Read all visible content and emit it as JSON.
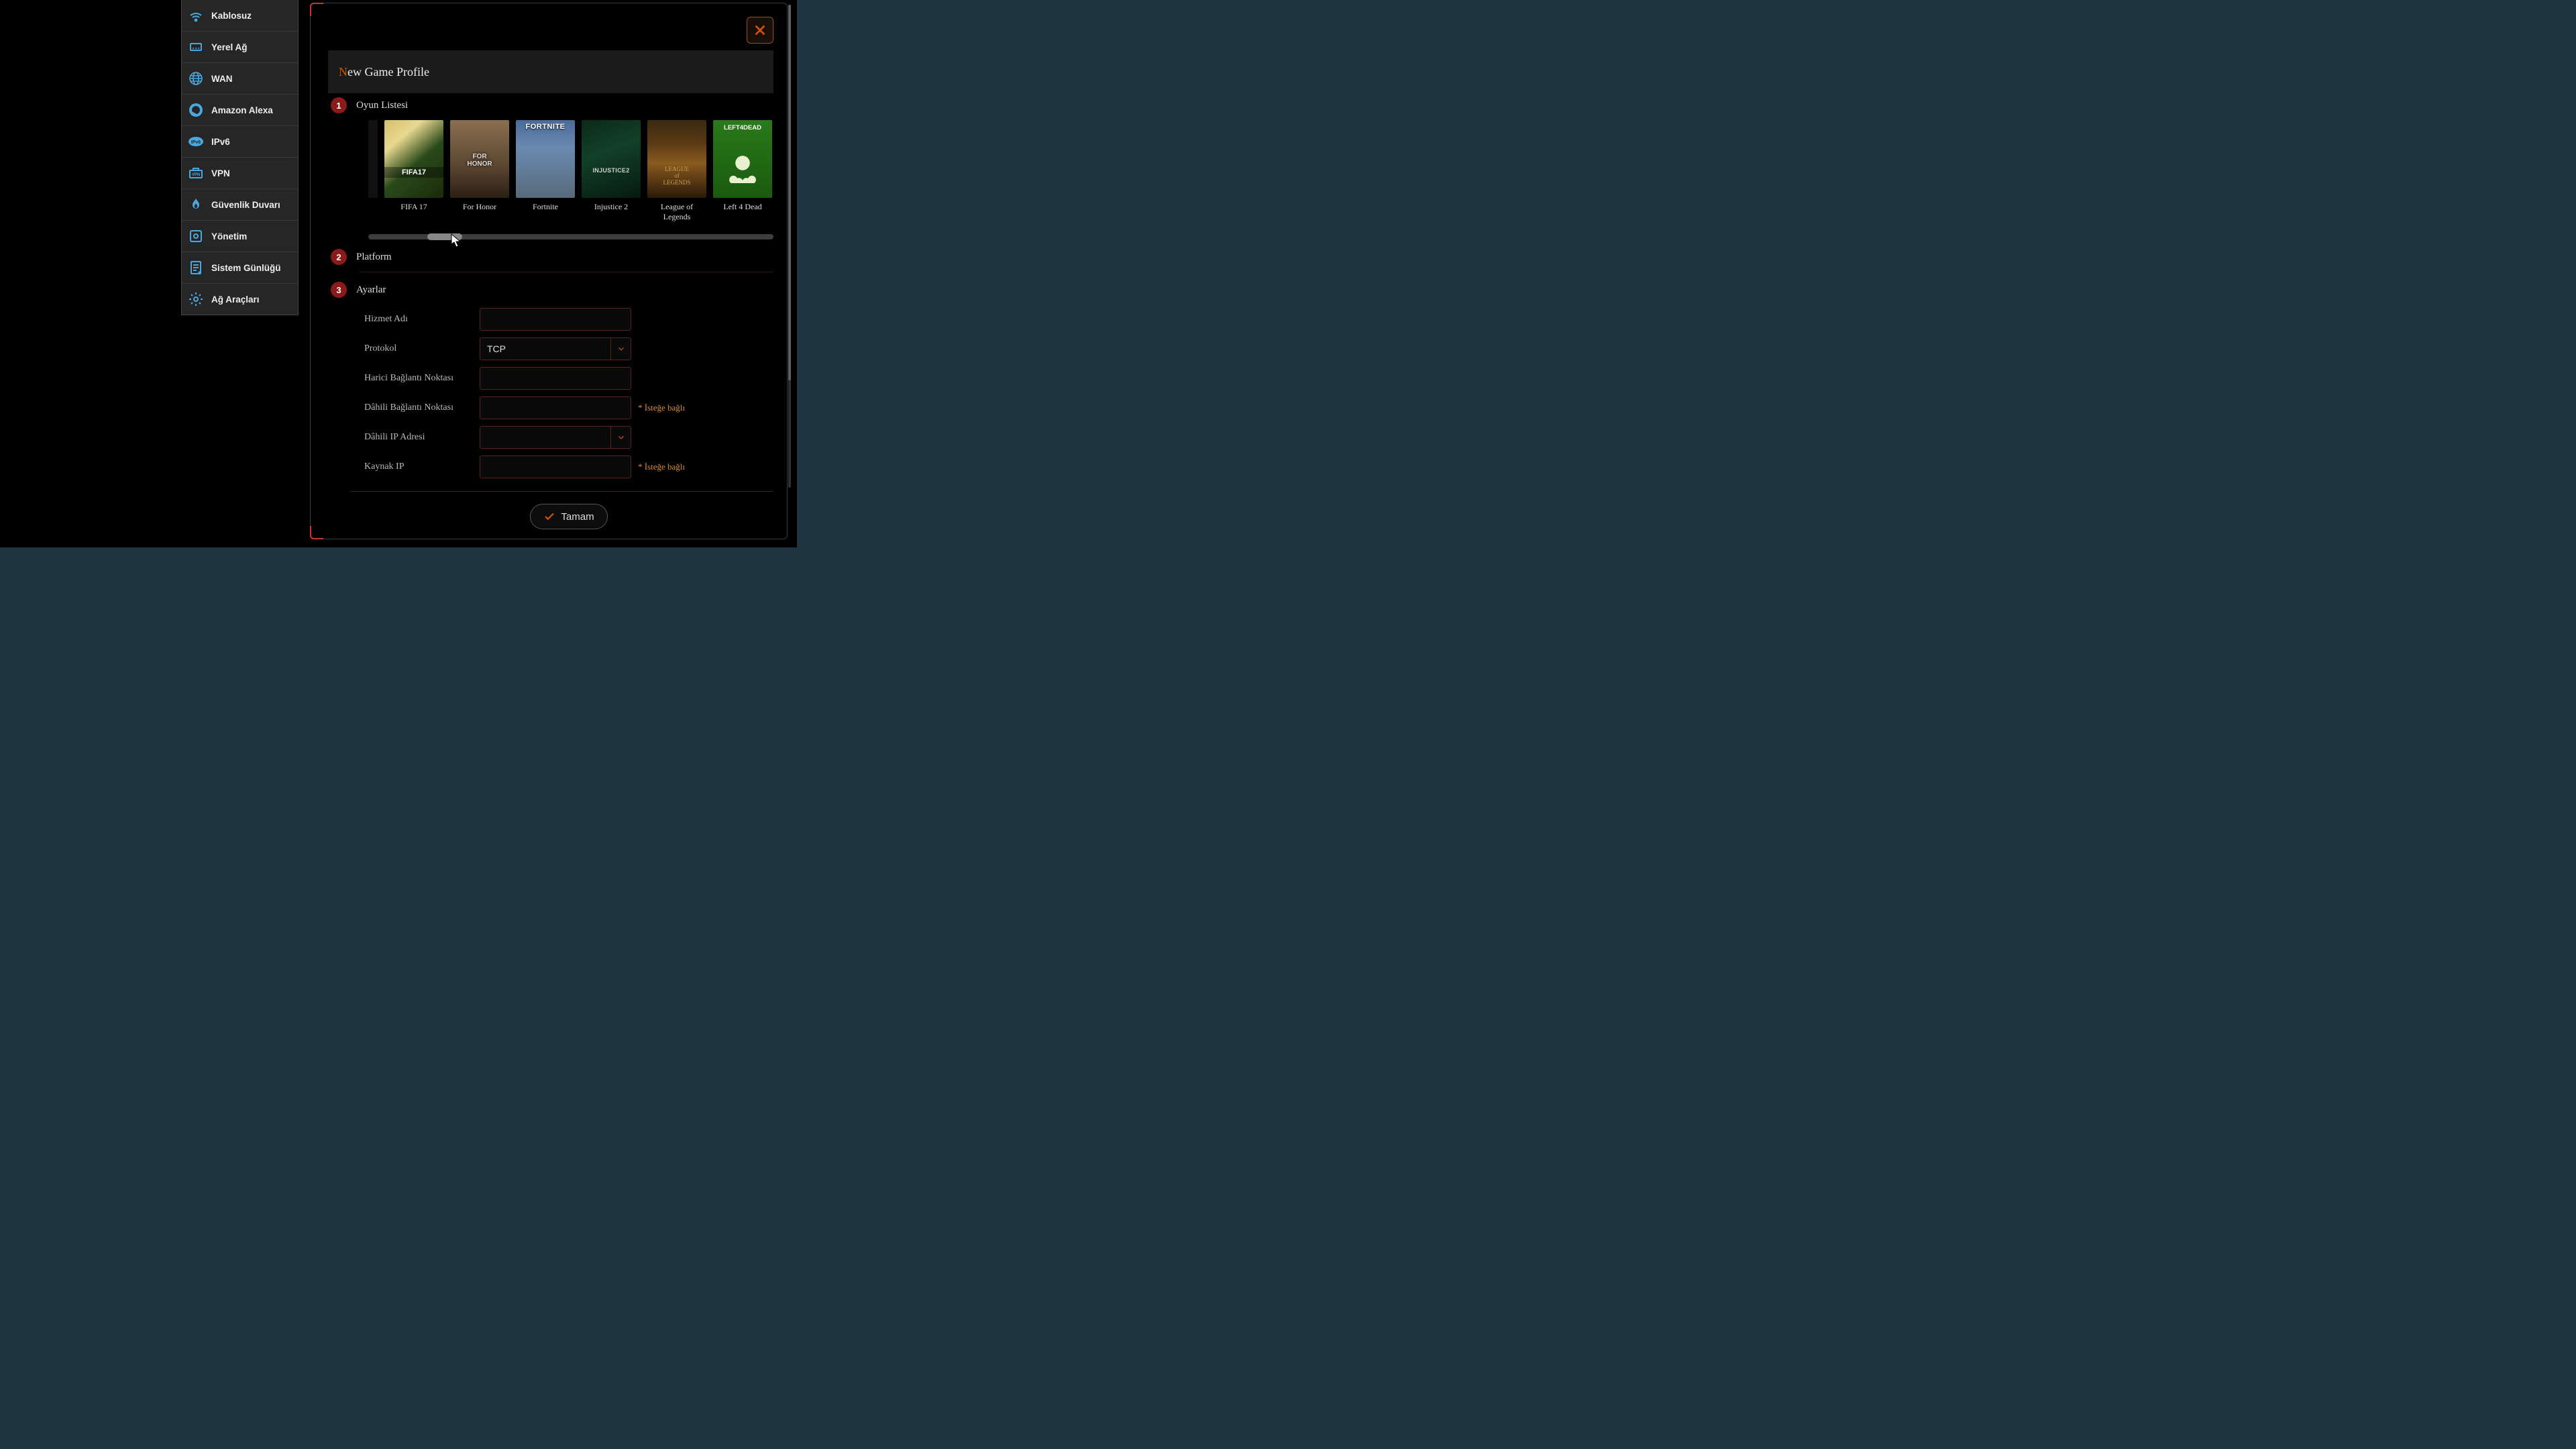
{
  "sidebar": {
    "items": [
      {
        "label": "Kablosuz",
        "icon": "wifi"
      },
      {
        "label": "Yerel Ağ",
        "icon": "lan"
      },
      {
        "label": "WAN",
        "icon": "globe"
      },
      {
        "label": "Amazon Alexa",
        "icon": "alexa"
      },
      {
        "label": "IPv6",
        "icon": "ipv6"
      },
      {
        "label": "VPN",
        "icon": "vpn"
      },
      {
        "label": "Güvenlik Duvarı",
        "icon": "firewall"
      },
      {
        "label": "Yönetim",
        "icon": "admin"
      },
      {
        "label": "Sistem Günlüğü",
        "icon": "log"
      },
      {
        "label": "Ağ Araçları",
        "icon": "tools"
      }
    ]
  },
  "modal": {
    "title_first": "N",
    "title_rest": "ew Game Profile",
    "steps": {
      "s1_num": "1",
      "s1_label": "Oyun Listesi",
      "s2_num": "2",
      "s2_label": "Platform",
      "s3_num": "3",
      "s3_label": "Ayarlar"
    },
    "games": [
      {
        "name": "FIFA 17"
      },
      {
        "name": "For Honor"
      },
      {
        "name": "Fortnite"
      },
      {
        "name": "Injustice 2"
      },
      {
        "name": "League of Legends"
      },
      {
        "name": "Left 4 Dead"
      }
    ],
    "form": {
      "service_name_label": "Hizmet Adı",
      "service_name_value": "",
      "protocol_label": "Protokol",
      "protocol_value": "TCP",
      "ext_port_label": "Harici Bağlantı Noktası",
      "ext_port_value": "",
      "int_port_label": "Dâhili Bağlantı Noktası",
      "int_port_value": "",
      "int_ip_label": "Dâhili IP Adresi",
      "int_ip_value": "",
      "src_ip_label": "Kaynak IP",
      "src_ip_value": "",
      "optional_text": "* İsteğe bağlı"
    },
    "ok_label": "Tamam"
  }
}
